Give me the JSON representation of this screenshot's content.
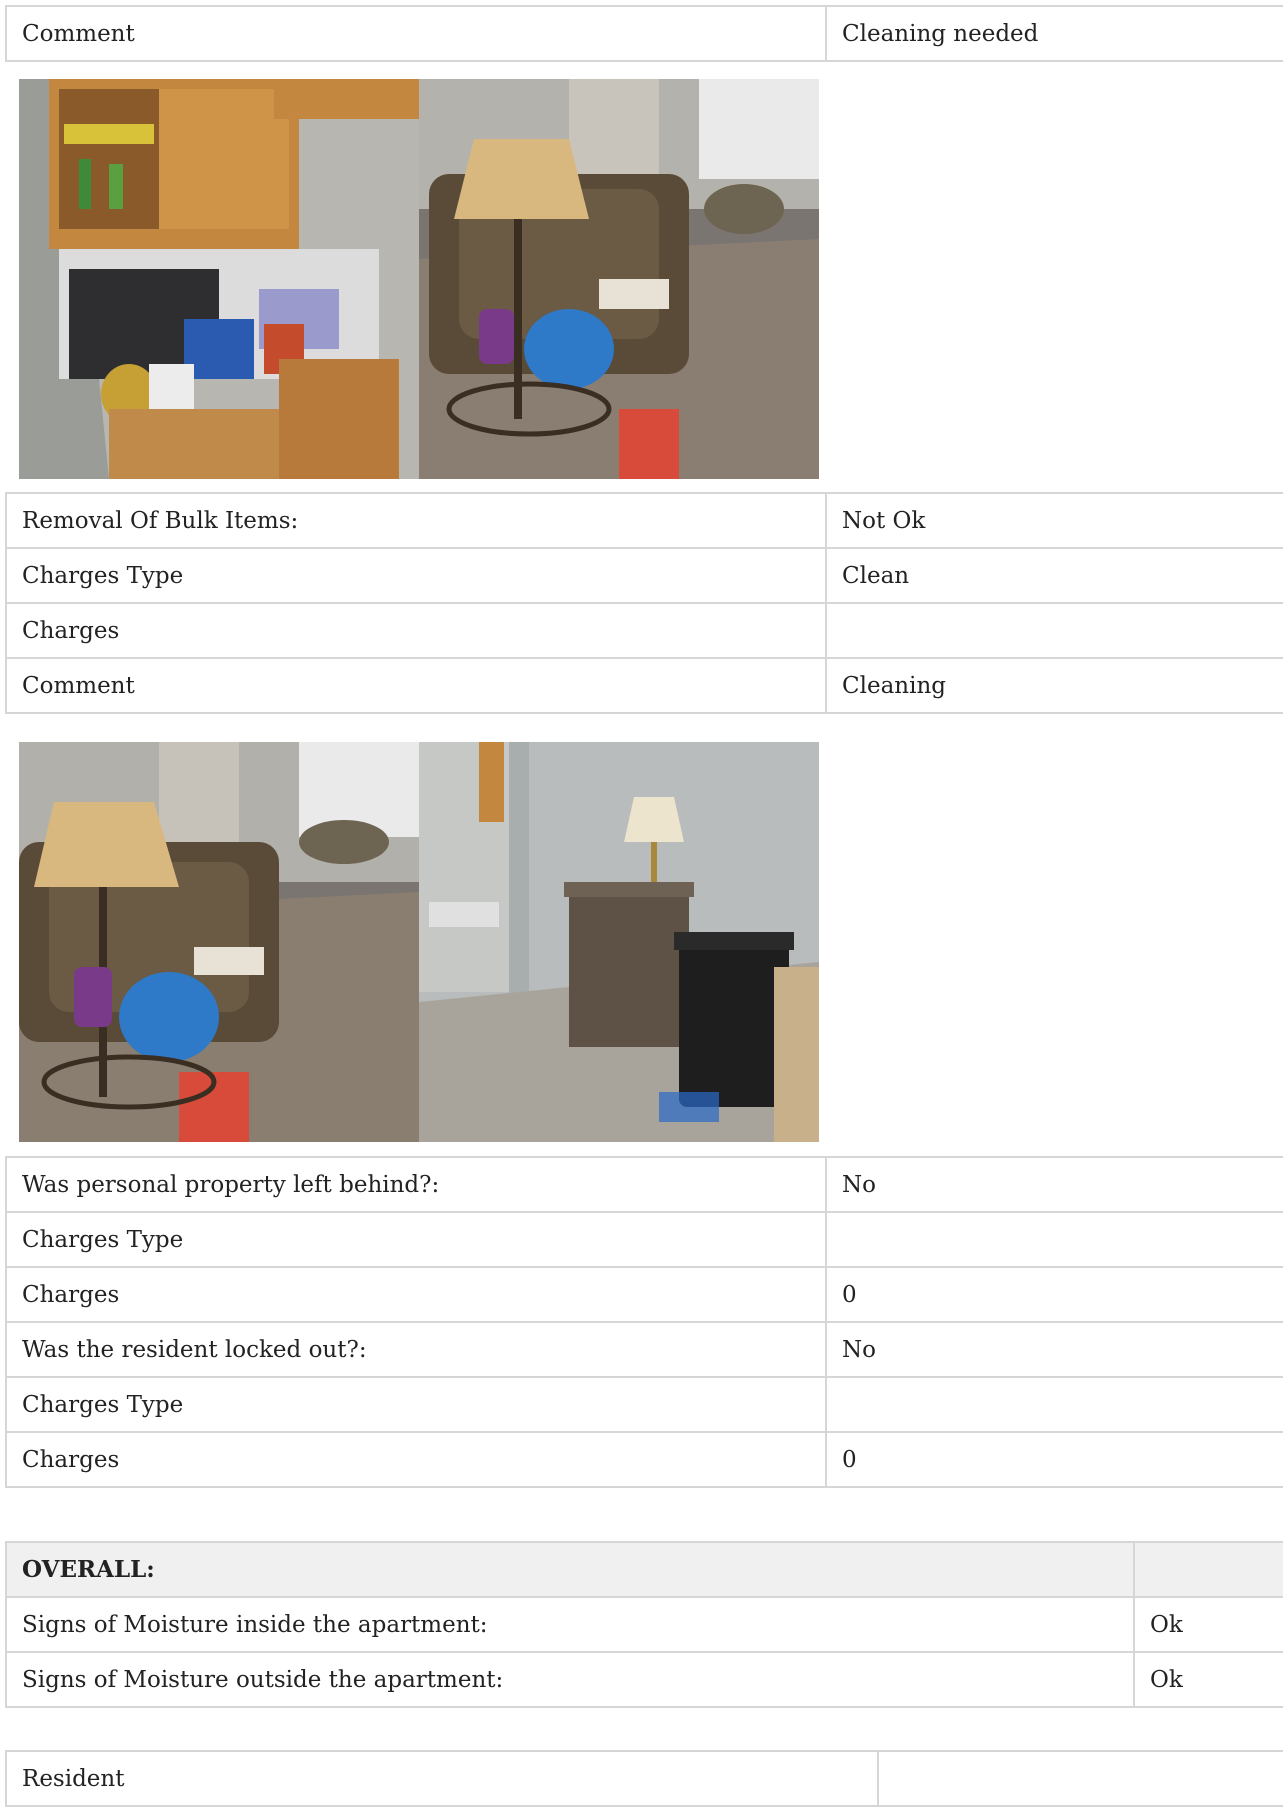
{
  "section1": {
    "rows": [
      {
        "label": "Comment",
        "value": "Cleaning needed"
      }
    ],
    "photos": [
      {
        "icon": "kitchen-counter-photo"
      },
      {
        "icon": "living-room-recliner-photo"
      }
    ]
  },
  "section2": {
    "rows": [
      {
        "label": "Removal Of Bulk Items:",
        "value": "Not Ok"
      },
      {
        "label": "Charges Type",
        "value": "Clean"
      },
      {
        "label": "Charges",
        "value": ""
      },
      {
        "label": "Comment",
        "value": "Cleaning"
      }
    ],
    "photos": [
      {
        "icon": "living-room-recliner-photo"
      },
      {
        "icon": "nightstand-trash-bin-photo"
      }
    ]
  },
  "section3": {
    "rows": [
      {
        "label": "Was personal property left behind?:",
        "value": "No"
      },
      {
        "label": "Charges Type",
        "value": ""
      },
      {
        "label": "Charges",
        "value": "0"
      },
      {
        "label": "Was the resident locked out?:",
        "value": "No"
      },
      {
        "label": "Charges Type",
        "value": ""
      },
      {
        "label": "Charges",
        "value": "0"
      }
    ]
  },
  "overall": {
    "header": "OVERALL:",
    "rows": [
      {
        "label": "Signs of Moisture inside the apartment:",
        "value": "Ok"
      },
      {
        "label": "Signs of Moisture outside the apartment:",
        "value": "Ok"
      }
    ]
  },
  "signature": {
    "rows": [
      {
        "label": "Resident",
        "value": ""
      }
    ]
  },
  "colors": {
    "border": "#d6d6d6",
    "header_bg": "#f0f0f0",
    "text": "#222222"
  }
}
